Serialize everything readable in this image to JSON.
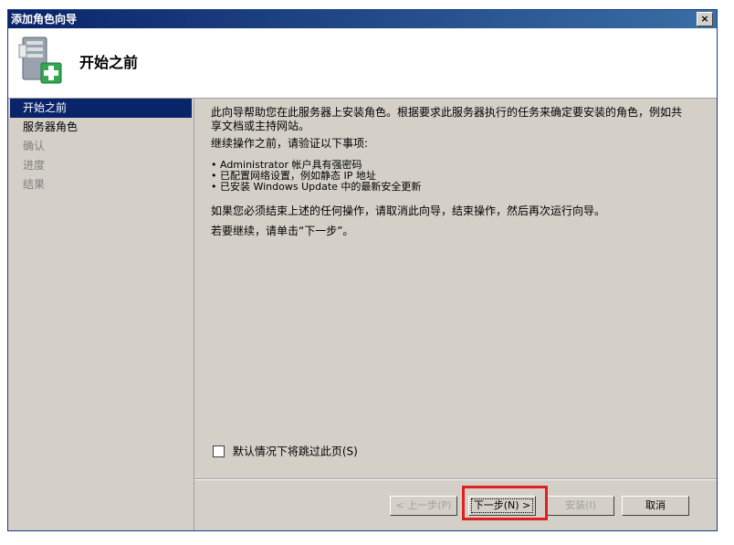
{
  "window": {
    "title": "添加角色向导",
    "close_label": "×"
  },
  "header": {
    "title": "开始之前",
    "icon": "server-add-icon"
  },
  "sidebar": {
    "items": [
      {
        "label": "开始之前",
        "state": "active"
      },
      {
        "label": "服务器角色",
        "state": "enabled"
      },
      {
        "label": "确认",
        "state": "disabled"
      },
      {
        "label": "进度",
        "state": "disabled"
      },
      {
        "label": "结果",
        "state": "disabled"
      }
    ]
  },
  "content": {
    "intro": "此向导帮助您在此服务器上安装角色。根据要求此服务器执行的任务来确定要安装的角色，例如共享文档或主持网站。",
    "verify_heading": "继续操作之前，请验证以下事项:",
    "bullets": [
      "• Administrator 帐户具有强密码",
      "• 已配置网络设置，例如静态 IP 地址",
      "• 已安装 Windows Update 中的最新安全更新"
    ],
    "cancel_note": "如果您必须结束上述的任何操作，请取消此向导，结束操作，然后再次运行向导。",
    "continue_note": "若要继续，请单击“下一步”。"
  },
  "skip_checkbox": {
    "label": "默认情况下将跳过此页(S)",
    "checked": false
  },
  "buttons": {
    "back": "< 上一步(P)",
    "next": "下一步(N) >",
    "install": "安装(I)",
    "cancel": "取消"
  },
  "colors": {
    "titlebar": "#0a246a",
    "highlight_box": "#e02020",
    "active_nav": "#0a246a"
  }
}
